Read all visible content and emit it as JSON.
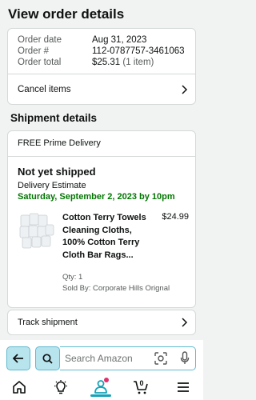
{
  "page": {
    "title": "View order details"
  },
  "order": {
    "date_label": "Order date",
    "date_value": "Aug 31, 2023",
    "number_label": "Order #",
    "number_value": "112-0787757-3461063",
    "total_label": "Order total",
    "total_value": "$25.31",
    "total_items": "(1 item)",
    "cancel_label": "Cancel items"
  },
  "shipment": {
    "section_title": "Shipment details",
    "delivery_type": "FREE Prime Delivery",
    "status": "Not yet shipped",
    "estimate_label": "Delivery Estimate",
    "estimate_date": "Saturday, September 2, 2023 by 10pm",
    "product": {
      "name": "Cotton Terry Towels Cleaning Cloths, 100% Cotton Terry Cloth Bar Rags...",
      "price": "$24.99",
      "qty": "Qty: 1",
      "seller": "Sold By: Corporate Hills Orignal"
    },
    "track_label": "Track shipment"
  },
  "search": {
    "placeholder": "Search Amazon"
  },
  "bottom_nav": {
    "cart_count": "0",
    "items": [
      "home-icon",
      "lightbulb-icon",
      "you-icon",
      "cart-icon",
      "menu-icon"
    ],
    "accent_color": "#14a3b8",
    "notification_color": "#e1306c"
  },
  "colors": {
    "delivery_green": "#007600",
    "search_button": "#b8e4ee"
  }
}
